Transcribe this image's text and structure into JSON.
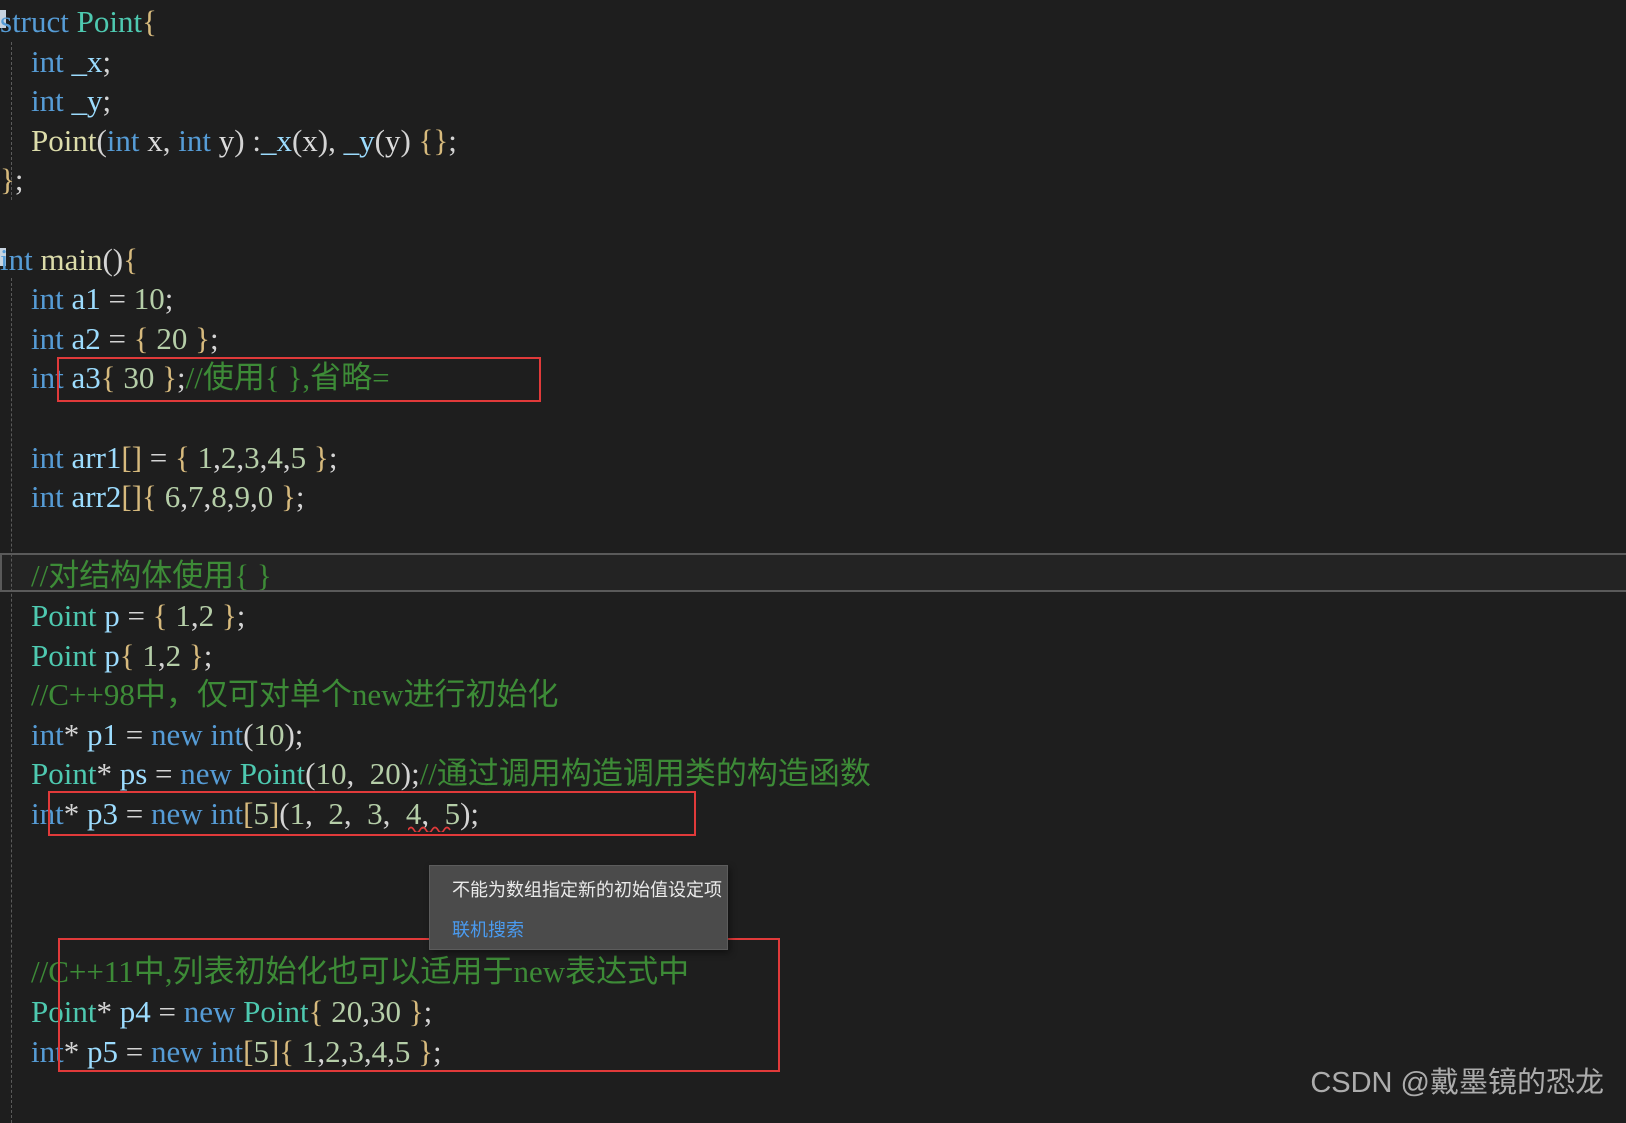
{
  "editor": {
    "background_color": "#1e1e1e",
    "comment_color": "#3d8b37",
    "keyword_color": "#569cd6",
    "type_color": "#4ec9b0",
    "number_color": "#b5cea8",
    "identifier_color": "#9cdcfe",
    "function_color": "#dcdcaa",
    "brace_color": "#d7ba7d",
    "annotation_box_color": "#e03a3a",
    "lines": [
      {
        "n": 1,
        "tokens": [
          {
            "t": "struct ",
            "c": "kw"
          },
          {
            "t": "Point",
            "c": "typ"
          },
          {
            "t": "{",
            "c": "brc"
          }
        ]
      },
      {
        "n": 2,
        "tokens": [
          {
            "t": "    ",
            "c": "pun"
          },
          {
            "t": "int",
            "c": "kw"
          },
          {
            "t": " ",
            "c": "pun"
          },
          {
            "t": "_x",
            "c": "id"
          },
          {
            "t": ";",
            "c": "pun"
          }
        ]
      },
      {
        "n": 3,
        "tokens": [
          {
            "t": "    ",
            "c": "pun"
          },
          {
            "t": "int",
            "c": "kw"
          },
          {
            "t": " ",
            "c": "pun"
          },
          {
            "t": "_y",
            "c": "id"
          },
          {
            "t": ";",
            "c": "pun"
          }
        ]
      },
      {
        "n": 4,
        "tokens": [
          {
            "t": "    ",
            "c": "pun"
          },
          {
            "t": "Point",
            "c": "fn"
          },
          {
            "t": "(",
            "c": "par"
          },
          {
            "t": "int",
            "c": "kw"
          },
          {
            "t": " ",
            "c": "pun"
          },
          {
            "t": "x",
            "c": "plain"
          },
          {
            "t": ", ",
            "c": "pun"
          },
          {
            "t": "int",
            "c": "kw"
          },
          {
            "t": " ",
            "c": "pun"
          },
          {
            "t": "y",
            "c": "plain"
          },
          {
            "t": ") :",
            "c": "par"
          },
          {
            "t": "_x",
            "c": "id"
          },
          {
            "t": "(",
            "c": "par"
          },
          {
            "t": "x",
            "c": "plain"
          },
          {
            "t": "), ",
            "c": "par"
          },
          {
            "t": "_y",
            "c": "id"
          },
          {
            "t": "(",
            "c": "par"
          },
          {
            "t": "y",
            "c": "plain"
          },
          {
            "t": ") ",
            "c": "par"
          },
          {
            "t": "{}",
            "c": "brc"
          },
          {
            "t": ";",
            "c": "pun"
          }
        ]
      },
      {
        "n": 5,
        "tokens": [
          {
            "t": "}",
            "c": "brc"
          },
          {
            "t": ";",
            "c": "pun"
          }
        ]
      },
      {
        "n": 6,
        "tokens": []
      },
      {
        "n": 7,
        "tokens": [
          {
            "t": "int",
            "c": "kw"
          },
          {
            "t": " ",
            "c": "pun"
          },
          {
            "t": "main",
            "c": "fn"
          },
          {
            "t": "()",
            "c": "par"
          },
          {
            "t": "{",
            "c": "brc"
          }
        ]
      },
      {
        "n": 8,
        "tokens": [
          {
            "t": "    ",
            "c": "pun"
          },
          {
            "t": "int",
            "c": "kw"
          },
          {
            "t": " ",
            "c": "pun"
          },
          {
            "t": "a1",
            "c": "id"
          },
          {
            "t": " = ",
            "c": "pun"
          },
          {
            "t": "10",
            "c": "num"
          },
          {
            "t": ";",
            "c": "pun"
          }
        ]
      },
      {
        "n": 9,
        "tokens": [
          {
            "t": "    ",
            "c": "pun"
          },
          {
            "t": "int",
            "c": "kw"
          },
          {
            "t": " ",
            "c": "pun"
          },
          {
            "t": "a2",
            "c": "id"
          },
          {
            "t": " = ",
            "c": "pun"
          },
          {
            "t": "{",
            "c": "brc"
          },
          {
            "t": " ",
            "c": "pun"
          },
          {
            "t": "20",
            "c": "num"
          },
          {
            "t": " ",
            "c": "pun"
          },
          {
            "t": "}",
            "c": "brc"
          },
          {
            "t": ";",
            "c": "pun"
          }
        ]
      },
      {
        "n": 10,
        "tokens": [
          {
            "t": "    ",
            "c": "pun"
          },
          {
            "t": "int",
            "c": "kw"
          },
          {
            "t": " ",
            "c": "pun"
          },
          {
            "t": "a3",
            "c": "id"
          },
          {
            "t": "{",
            "c": "brc"
          },
          {
            "t": " ",
            "c": "pun"
          },
          {
            "t": "30",
            "c": "num"
          },
          {
            "t": " ",
            "c": "pun"
          },
          {
            "t": "}",
            "c": "brc"
          },
          {
            "t": ";",
            "c": "pun"
          },
          {
            "t": "//使用{ },省略=",
            "c": "cmt"
          }
        ]
      },
      {
        "n": 11,
        "tokens": []
      },
      {
        "n": 12,
        "tokens": [
          {
            "t": "    ",
            "c": "pun"
          },
          {
            "t": "int",
            "c": "kw"
          },
          {
            "t": " ",
            "c": "pun"
          },
          {
            "t": "arr1",
            "c": "id"
          },
          {
            "t": "[]",
            "c": "brc"
          },
          {
            "t": " = ",
            "c": "pun"
          },
          {
            "t": "{",
            "c": "brc"
          },
          {
            "t": " ",
            "c": "pun"
          },
          {
            "t": "1",
            "c": "num"
          },
          {
            "t": ",",
            "c": "pun"
          },
          {
            "t": "2",
            "c": "num"
          },
          {
            "t": ",",
            "c": "pun"
          },
          {
            "t": "3",
            "c": "num"
          },
          {
            "t": ",",
            "c": "pun"
          },
          {
            "t": "4",
            "c": "num"
          },
          {
            "t": ",",
            "c": "pun"
          },
          {
            "t": "5",
            "c": "num"
          },
          {
            "t": " ",
            "c": "pun"
          },
          {
            "t": "}",
            "c": "brc"
          },
          {
            "t": ";",
            "c": "pun"
          }
        ]
      },
      {
        "n": 13,
        "tokens": [
          {
            "t": "    ",
            "c": "pun"
          },
          {
            "t": "int",
            "c": "kw"
          },
          {
            "t": " ",
            "c": "pun"
          },
          {
            "t": "arr2",
            "c": "id"
          },
          {
            "t": "[]",
            "c": "brc"
          },
          {
            "t": "{",
            "c": "brc"
          },
          {
            "t": " ",
            "c": "pun"
          },
          {
            "t": "6",
            "c": "num"
          },
          {
            "t": ",",
            "c": "pun"
          },
          {
            "t": "7",
            "c": "num"
          },
          {
            "t": ",",
            "c": "pun"
          },
          {
            "t": "8",
            "c": "num"
          },
          {
            "t": ",",
            "c": "pun"
          },
          {
            "t": "9",
            "c": "num"
          },
          {
            "t": ",",
            "c": "pun"
          },
          {
            "t": "0",
            "c": "num"
          },
          {
            "t": " ",
            "c": "pun"
          },
          {
            "t": "}",
            "c": "brc"
          },
          {
            "t": ";",
            "c": "pun"
          }
        ]
      },
      {
        "n": 14,
        "tokens": []
      },
      {
        "n": 15,
        "tokens": [
          {
            "t": "    ",
            "c": "pun"
          },
          {
            "t": "//对结构体使用{ }",
            "c": "cmt"
          }
        ]
      },
      {
        "n": 16,
        "tokens": [
          {
            "t": "    ",
            "c": "pun"
          },
          {
            "t": "Point",
            "c": "typ"
          },
          {
            "t": " ",
            "c": "pun"
          },
          {
            "t": "p",
            "c": "id"
          },
          {
            "t": " = ",
            "c": "pun"
          },
          {
            "t": "{",
            "c": "brc"
          },
          {
            "t": " ",
            "c": "pun"
          },
          {
            "t": "1",
            "c": "num"
          },
          {
            "t": ",",
            "c": "pun"
          },
          {
            "t": "2",
            "c": "num"
          },
          {
            "t": " ",
            "c": "pun"
          },
          {
            "t": "}",
            "c": "brc"
          },
          {
            "t": ";",
            "c": "pun"
          }
        ]
      },
      {
        "n": 17,
        "tokens": [
          {
            "t": "    ",
            "c": "pun"
          },
          {
            "t": "Point",
            "c": "typ"
          },
          {
            "t": " ",
            "c": "pun"
          },
          {
            "t": "p",
            "c": "id"
          },
          {
            "t": "{",
            "c": "brc"
          },
          {
            "t": " ",
            "c": "pun"
          },
          {
            "t": "1",
            "c": "num"
          },
          {
            "t": ",",
            "c": "pun"
          },
          {
            "t": "2",
            "c": "num"
          },
          {
            "t": " ",
            "c": "pun"
          },
          {
            "t": "}",
            "c": "brc"
          },
          {
            "t": ";",
            "c": "pun"
          }
        ]
      },
      {
        "n": 18,
        "tokens": [
          {
            "t": "    ",
            "c": "pun"
          },
          {
            "t": "//C++98中，仅可对单个new进行初始化",
            "c": "cmt"
          }
        ]
      },
      {
        "n": 19,
        "tokens": [
          {
            "t": "    ",
            "c": "pun"
          },
          {
            "t": "int",
            "c": "kw"
          },
          {
            "t": "* ",
            "c": "pun"
          },
          {
            "t": "p1",
            "c": "id"
          },
          {
            "t": " = ",
            "c": "pun"
          },
          {
            "t": "new",
            "c": "kw"
          },
          {
            "t": " ",
            "c": "pun"
          },
          {
            "t": "int",
            "c": "kw"
          },
          {
            "t": "(",
            "c": "par"
          },
          {
            "t": "10",
            "c": "num"
          },
          {
            "t": ")",
            "c": "par"
          },
          {
            "t": ";",
            "c": "pun"
          }
        ]
      },
      {
        "n": 20,
        "tokens": [
          {
            "t": "    ",
            "c": "pun"
          },
          {
            "t": "Point",
            "c": "typ"
          },
          {
            "t": "* ",
            "c": "pun"
          },
          {
            "t": "ps",
            "c": "id"
          },
          {
            "t": " = ",
            "c": "pun"
          },
          {
            "t": "new",
            "c": "kw"
          },
          {
            "t": " ",
            "c": "pun"
          },
          {
            "t": "Point",
            "c": "typ"
          },
          {
            "t": "(",
            "c": "par"
          },
          {
            "t": "10",
            "c": "num"
          },
          {
            "t": ", ",
            "c": "pun"
          },
          {
            "t": " 20",
            "c": "num"
          },
          {
            "t": ")",
            "c": "par"
          },
          {
            "t": ";",
            "c": "pun"
          },
          {
            "t": "//通过调用构造调用类的构造函数",
            "c": "cmt"
          }
        ]
      },
      {
        "n": 21,
        "tokens": [
          {
            "t": "    ",
            "c": "pun"
          },
          {
            "t": "int",
            "c": "kw"
          },
          {
            "t": "* ",
            "c": "pun"
          },
          {
            "t": "p3",
            "c": "id"
          },
          {
            "t": " = ",
            "c": "pun"
          },
          {
            "t": "new",
            "c": "kw"
          },
          {
            "t": " ",
            "c": "pun"
          },
          {
            "t": "int",
            "c": "kw"
          },
          {
            "t": "[",
            "c": "brc"
          },
          {
            "t": "5",
            "c": "num"
          },
          {
            "t": "]",
            "c": "brc"
          },
          {
            "t": "(",
            "c": "par"
          },
          {
            "t": "1",
            "c": "num"
          },
          {
            "t": ", ",
            "c": "pun"
          },
          {
            "t": " 2",
            "c": "num"
          },
          {
            "t": ", ",
            "c": "pun"
          },
          {
            "t": " 3",
            "c": "num"
          },
          {
            "t": ", ",
            "c": "pun"
          },
          {
            "t": " 4",
            "c": "num"
          },
          {
            "t": ", ",
            "c": "pun"
          },
          {
            "t": " 5",
            "c": "num"
          },
          {
            "t": ")",
            "c": "par"
          },
          {
            "t": ";",
            "c": "pun"
          }
        ]
      },
      {
        "n": 22,
        "tokens": []
      },
      {
        "n": 23,
        "tokens": []
      },
      {
        "n": 24,
        "tokens": []
      },
      {
        "n": 25,
        "tokens": [
          {
            "t": "    ",
            "c": "pun"
          },
          {
            "t": "//C++11中,列表初始化也可以适用于new表达式中",
            "c": "cmt"
          }
        ]
      },
      {
        "n": 26,
        "tokens": [
          {
            "t": "    ",
            "c": "pun"
          },
          {
            "t": "Point",
            "c": "typ"
          },
          {
            "t": "* ",
            "c": "pun"
          },
          {
            "t": "p4",
            "c": "id"
          },
          {
            "t": " = ",
            "c": "pun"
          },
          {
            "t": "new",
            "c": "kw"
          },
          {
            "t": " ",
            "c": "pun"
          },
          {
            "t": "Point",
            "c": "typ"
          },
          {
            "t": "{",
            "c": "brc"
          },
          {
            "t": " ",
            "c": "pun"
          },
          {
            "t": "20",
            "c": "num"
          },
          {
            "t": ",",
            "c": "pun"
          },
          {
            "t": "30",
            "c": "num"
          },
          {
            "t": " ",
            "c": "pun"
          },
          {
            "t": "}",
            "c": "brc"
          },
          {
            "t": ";",
            "c": "pun"
          }
        ]
      },
      {
        "n": 27,
        "tokens": [
          {
            "t": "    ",
            "c": "pun"
          },
          {
            "t": "int",
            "c": "kw"
          },
          {
            "t": "* ",
            "c": "pun"
          },
          {
            "t": "p5",
            "c": "id"
          },
          {
            "t": " = ",
            "c": "pun"
          },
          {
            "t": "new",
            "c": "kw"
          },
          {
            "t": " ",
            "c": "pun"
          },
          {
            "t": "int",
            "c": "kw"
          },
          {
            "t": "[",
            "c": "brc"
          },
          {
            "t": "5",
            "c": "num"
          },
          {
            "t": "]",
            "c": "brc"
          },
          {
            "t": "{",
            "c": "brc"
          },
          {
            "t": " ",
            "c": "pun"
          },
          {
            "t": "1",
            "c": "num"
          },
          {
            "t": ",",
            "c": "pun"
          },
          {
            "t": "2",
            "c": "num"
          },
          {
            "t": ",",
            "c": "pun"
          },
          {
            "t": "3",
            "c": "num"
          },
          {
            "t": ",",
            "c": "pun"
          },
          {
            "t": "4",
            "c": "num"
          },
          {
            "t": ",",
            "c": "pun"
          },
          {
            "t": "5",
            "c": "num"
          },
          {
            "t": " ",
            "c": "pun"
          },
          {
            "t": "}",
            "c": "brc"
          },
          {
            "t": ";",
            "c": "pun"
          }
        ]
      }
    ]
  },
  "tooltip": {
    "message": "不能为数组指定新的初始值设定项",
    "link_label": "联机搜索",
    "background_color": "#4b4b4b",
    "link_color": "#4a9bf0"
  },
  "annotations": {
    "box_1_target_line": 10,
    "box_2_target_line": 21,
    "box_3_target_lines": "25-27"
  },
  "watermark": {
    "text": "CSDN @戴墨镜的恐龙"
  }
}
